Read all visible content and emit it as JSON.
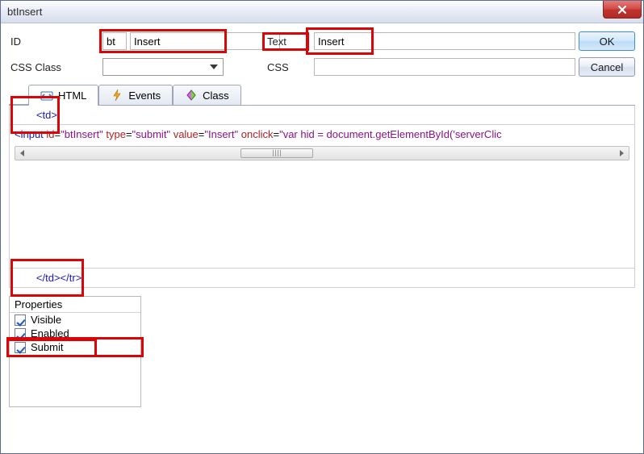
{
  "window": {
    "title": "btInsert"
  },
  "form": {
    "id_label": "ID",
    "id_prefix": "bt",
    "id_value": "Insert",
    "text_label": "Text",
    "text_value": "Insert",
    "css_class_label": "CSS Class",
    "css_class_value": "",
    "css_label": "CSS",
    "css_value": ""
  },
  "buttons": {
    "ok": "OK",
    "cancel": "Cancel"
  },
  "tabs": {
    "html": "HTML",
    "events": "Events",
    "class": "Class"
  },
  "code": {
    "prefix": "<td>",
    "line_tokens": [
      {
        "t": "<input",
        "c": "c-blue"
      },
      {
        "t": " ",
        "c": "c-black"
      },
      {
        "t": "id",
        "c": "c-red"
      },
      {
        "t": "=",
        "c": "c-black"
      },
      {
        "t": "\"btInsert\"",
        "c": "c-str"
      },
      {
        "t": " ",
        "c": "c-black"
      },
      {
        "t": "type",
        "c": "c-red"
      },
      {
        "t": "=",
        "c": "c-black"
      },
      {
        "t": "\"submit\"",
        "c": "c-str"
      },
      {
        "t": " ",
        "c": "c-black"
      },
      {
        "t": "value",
        "c": "c-red"
      },
      {
        "t": "=",
        "c": "c-black"
      },
      {
        "t": "\"Insert\"",
        "c": "c-str"
      },
      {
        "t": " ",
        "c": "c-black"
      },
      {
        "t": "onclick",
        "c": "c-red"
      },
      {
        "t": "=",
        "c": "c-black"
      },
      {
        "t": "\"var hid = document.getElementById('serverClic",
        "c": "c-str"
      }
    ],
    "suffix": "</td></tr>"
  },
  "properties": {
    "title": "Properties",
    "items": [
      {
        "label": "Visible",
        "checked": true
      },
      {
        "label": "Enabled",
        "checked": true
      },
      {
        "label": "Submit",
        "checked": true
      }
    ]
  },
  "icons": {
    "html": "html-tag-icon",
    "events": "lightning-icon",
    "class": "class-diamond-icon",
    "close": "close-icon",
    "dropdown": "chevron-down-icon",
    "scroll_left": "triangle-left-icon",
    "scroll_right": "triangle-right-icon"
  },
  "highlights": [
    "id-fields",
    "text-fields",
    "prefix-line",
    "suffix-line",
    "prop-submit"
  ]
}
